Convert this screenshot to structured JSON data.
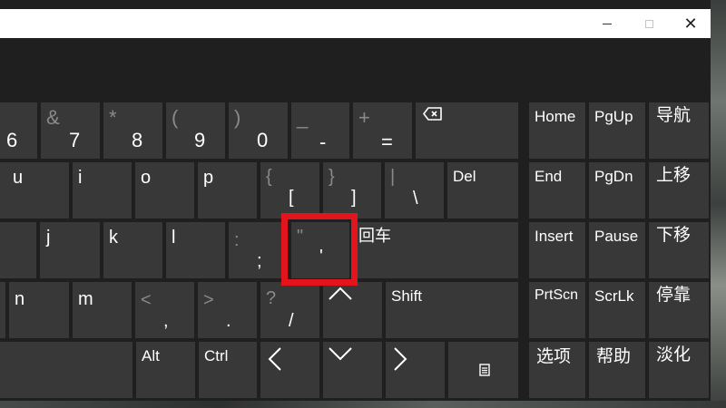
{
  "window": {
    "minimize_glyph": "minimize",
    "maximize_glyph": "maximize",
    "close_glyph": "✕"
  },
  "keys": {
    "k6": {
      "main": "6"
    },
    "k7": {
      "main": "7",
      "sec": "&"
    },
    "k8": {
      "main": "8",
      "sec": "*"
    },
    "k9": {
      "main": "9",
      "sec": "("
    },
    "k0": {
      "main": "0",
      "sec": ")"
    },
    "minus": {
      "main": "-",
      "sec": "_"
    },
    "equals": {
      "main": "=",
      "sec": "+"
    },
    "u": {
      "main": "u"
    },
    "i": {
      "main": "i"
    },
    "o": {
      "main": "o"
    },
    "p": {
      "main": "p"
    },
    "lbracket": {
      "main": "[",
      "sec": "{"
    },
    "rbracket": {
      "main": "]",
      "sec": "}"
    },
    "backslash": {
      "main": "\\",
      "sec": "|"
    },
    "del": {
      "main": "Del"
    },
    "j": {
      "main": "j"
    },
    "k": {
      "main": "k"
    },
    "l": {
      "main": "l"
    },
    "semicolon": {
      "main": ";",
      "sec": ":"
    },
    "quote": {
      "main": "'",
      "sec": "\""
    },
    "enter": {
      "main": "回车"
    },
    "n": {
      "main": "n"
    },
    "m": {
      "main": "m"
    },
    "comma": {
      "main": ",",
      "sec": "<"
    },
    "period": {
      "main": ".",
      "sec": ">"
    },
    "slash": {
      "main": "/",
      "sec": "?"
    },
    "shift": {
      "main": "Shift"
    },
    "alt": {
      "main": "Alt"
    },
    "ctrl": {
      "main": "Ctrl"
    },
    "home": {
      "main": "Home"
    },
    "pgup": {
      "main": "PgUp"
    },
    "nav": {
      "main": "导航"
    },
    "end": {
      "main": "End"
    },
    "pgdn": {
      "main": "PgDn"
    },
    "moveup": {
      "main": "上移"
    },
    "insert": {
      "main": "Insert"
    },
    "pause": {
      "main": "Pause"
    },
    "movedown": {
      "main": "下移"
    },
    "prtscn": {
      "main": "PrtScn"
    },
    "scrlk": {
      "main": "ScrLk"
    },
    "dock": {
      "main": "停靠"
    },
    "options": {
      "main": "选项"
    },
    "help": {
      "main": "帮助"
    },
    "fade": {
      "main": "淡化"
    }
  },
  "icons": {
    "backspace": "backspace-icon",
    "up": "arrow-up-icon",
    "left": "arrow-left-icon",
    "down": "arrow-down-icon",
    "right": "arrow-right-icon",
    "menu": "menu-key-icon"
  },
  "colors": {
    "key_bg": "#383838",
    "window_bg": "#1f1f1f",
    "secondary_text": "#8a8a8a",
    "highlight": "#e3141b"
  }
}
